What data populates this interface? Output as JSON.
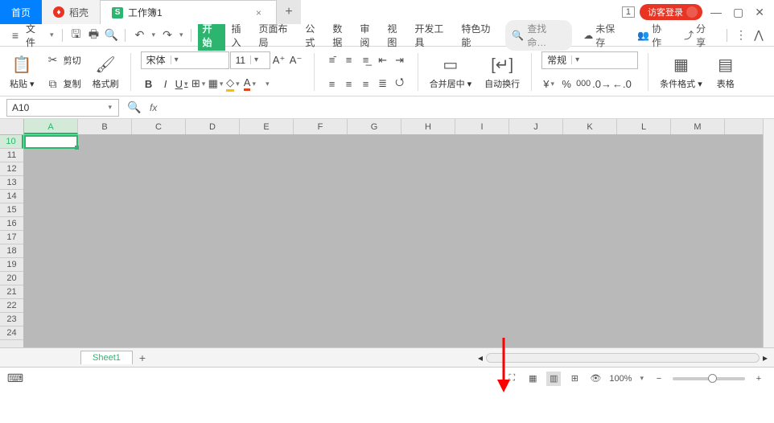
{
  "tabs": {
    "home": "首页",
    "shell": "稻壳",
    "doc": "工作簿1"
  },
  "titleright": {
    "one": "1",
    "login": "访客登录"
  },
  "menubar": {
    "file": "文件",
    "items": [
      "开始",
      "插入",
      "页面布局",
      "公式",
      "数据",
      "审阅",
      "视图",
      "开发工具",
      "特色功能"
    ],
    "search_placeholder": "查找命…",
    "unsaved": "未保存",
    "coop": "协作",
    "share": "分享"
  },
  "ribbon": {
    "cut": "剪切",
    "copy": "复制",
    "formatpainter": "格式刷",
    "paste": "粘贴",
    "font": "宋体",
    "size": "11",
    "merge": "合并居中",
    "wrap": "自动换行",
    "numfmt": "常规",
    "condfmt": "条件格式",
    "tablefmt": "表格"
  },
  "namebox": "A10",
  "columns": [
    "A",
    "B",
    "C",
    "D",
    "E",
    "F",
    "G",
    "H",
    "I",
    "J",
    "K",
    "L",
    "M"
  ],
  "rows": [
    10,
    11,
    12,
    13,
    14,
    15,
    16,
    17,
    18,
    19,
    20,
    21,
    22,
    23,
    24
  ],
  "sheet": "Sheet1",
  "zoom": "100%"
}
